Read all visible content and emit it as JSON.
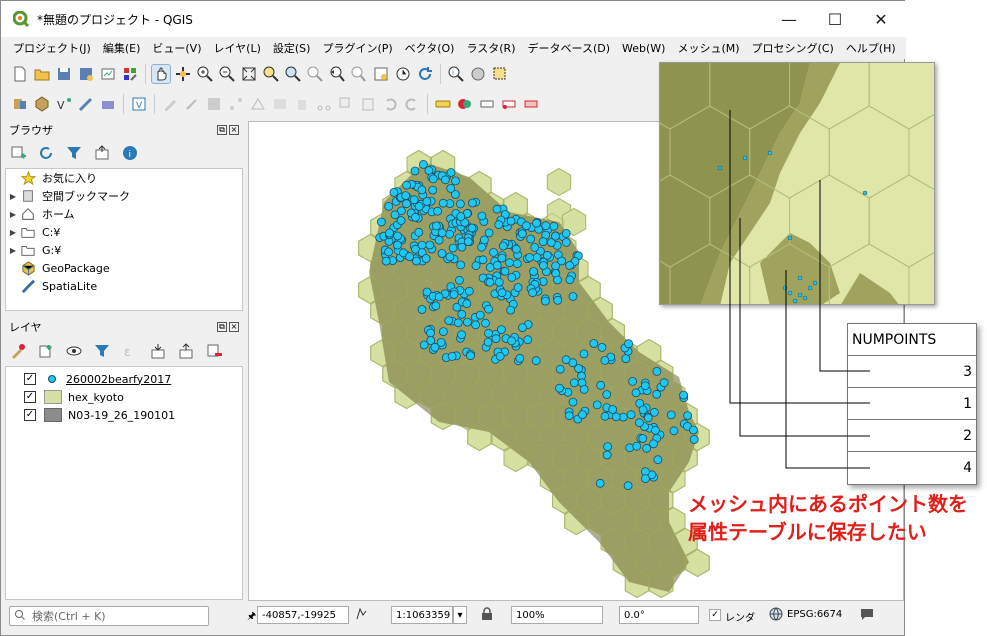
{
  "window": {
    "title": "*無題のプロジェクト - QGIS",
    "minimize": "—",
    "maximize": "☐",
    "close": "✕"
  },
  "menu": [
    "プロジェクト(J)",
    "編集(E)",
    "ビュー(V)",
    "レイヤ(L)",
    "設定(S)",
    "プラグイン(P)",
    "ベクタ(O)",
    "ラスタ(R)",
    "データベース(D)",
    "Web(W)",
    "メッシュ(M)",
    "プロセシング(C)",
    "ヘルプ(H)"
  ],
  "browser": {
    "title": "ブラウザ",
    "items": [
      {
        "label": "お気に入り",
        "icon": "star-icon",
        "expand": ""
      },
      {
        "label": "空間ブックマーク",
        "icon": "bookmark-icon",
        "expand": "▶"
      },
      {
        "label": "ホーム",
        "icon": "home-icon",
        "expand": "▶"
      },
      {
        "label": "C:¥",
        "icon": "folder-icon",
        "expand": "▶"
      },
      {
        "label": "G:¥",
        "icon": "folder-icon",
        "expand": "▶"
      },
      {
        "label": "GeoPackage",
        "icon": "geopackage-icon",
        "expand": ""
      },
      {
        "label": "SpatiaLite",
        "icon": "spatialite-icon",
        "expand": ""
      }
    ]
  },
  "layers": {
    "title": "レイヤ",
    "items": [
      {
        "label": "260002bearfy2017",
        "checked": "✓",
        "swatch": "#1ec8f0"
      },
      {
        "label": "hex_kyoto",
        "checked": "✓",
        "swatch": "#d6e0a0"
      },
      {
        "label": "N03-19_26_190101",
        "checked": "✓",
        "swatch": "#8c8c8c"
      }
    ]
  },
  "status": {
    "search_placeholder": "検索(Ctrl + K)",
    "coordinate": "-40857,-19925",
    "scale": "1:1063359",
    "magnifier": "100%",
    "rotation": "0.0°",
    "render_label": "レンダ",
    "crs": "EPSG:6674"
  },
  "attribute_table": {
    "header": "NUMPOINTS",
    "values": [
      "3",
      "1",
      "2",
      "4"
    ]
  },
  "caption": {
    "line1": "メッシュ内にあるポイント数を",
    "line2": "属性テーブルに保存したい"
  },
  "colors": {
    "hex_fill": "#d6e0a0",
    "hex_stroke": "#a9b56b",
    "pref_fill": "#8c8f5e",
    "point_fill": "#1ec8f0",
    "caption_red": "#e0201b"
  }
}
